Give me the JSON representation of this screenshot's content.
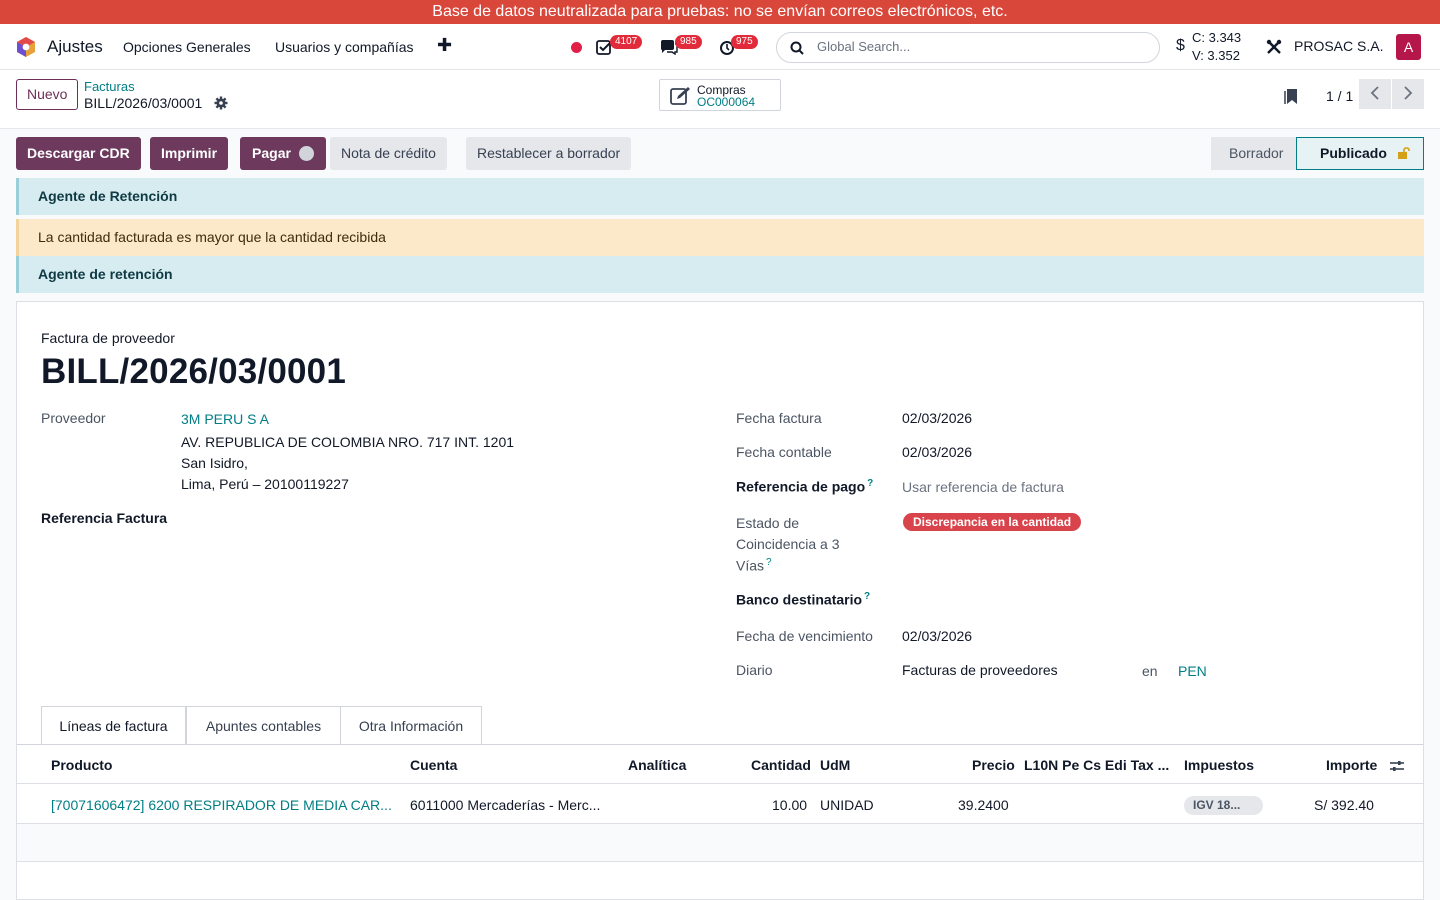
{
  "banner": {
    "text": "Base de datos neutralizada para pruebas: no se envían correos electrónicos, etc."
  },
  "navbar": {
    "app_name": "Ajustes",
    "menu": [
      "Opciones Generales",
      "Usuarios y compañías"
    ],
    "plus": "✚",
    "badges": {
      "activities": "4107",
      "messages": "985",
      "timer": "975"
    },
    "search_placeholder": "Global Search...",
    "rate_symbol": "$",
    "rate_buy": "C: 3.343",
    "rate_sell": "V: 3.352",
    "company": "PROSAC S.A.",
    "avatar_letter": "A"
  },
  "control": {
    "new_button": "Nuevo",
    "breadcrumb_parent": "Facturas",
    "breadcrumb_current": "BILL/2026/03/0001",
    "smart_button_label": "Compras",
    "smart_button_value": "OC000064",
    "pager": "1 / 1"
  },
  "actions": {
    "download_cdr": "Descargar CDR",
    "print": "Imprimir",
    "pay": "Pagar",
    "credit_note": "Nota de crédito",
    "reset_draft": "Restablecer a borrador"
  },
  "statusbar": {
    "draft": "Borrador",
    "posted": "Publicado"
  },
  "alerts": [
    {
      "type": "info",
      "text": "Agente de Retención"
    },
    {
      "type": "warning",
      "text": "La cantidad facturada es mayor que la cantidad recibida"
    },
    {
      "type": "info",
      "text": "Agente de retención"
    }
  ],
  "form": {
    "doc_type": "Factura de proveedor",
    "title": "BILL/2026/03/0001",
    "vendor_label": "Proveedor",
    "vendor_name": "3M PERU S A",
    "vendor_address": [
      "AV. REPUBLICA DE COLOMBIA NRO. 717 INT. 1201",
      "San Isidro,",
      "Lima, Perú – 20100119227"
    ],
    "ref_label": "Referencia Factura",
    "invoice_date_label": "Fecha factura",
    "invoice_date": "02/03/2026",
    "accounting_date_label": "Fecha contable",
    "accounting_date": "02/03/2026",
    "payment_ref_label": "Referencia de pago",
    "payment_ref_placeholder": "Usar referencia de factura",
    "three_way_label": [
      "Estado de",
      "Coincidencia a 3",
      "Vías"
    ],
    "three_way_value": "Discrepancia en la cantidad",
    "bank_label": "Banco destinatario",
    "due_date_label": "Fecha de vencimiento",
    "due_date": "02/03/2026",
    "journal_label": "Diario",
    "journal": "Facturas de proveedores",
    "currency_in": "en",
    "currency": "PEN",
    "help_mark": "?"
  },
  "tabs": [
    "Líneas de factura",
    "Apuntes contables",
    "Otra Información"
  ],
  "lines": {
    "headers": [
      "Producto",
      "Cuenta",
      "Analítica",
      "Cantidad",
      "UdM",
      "Precio",
      "L10N Pe Cs Edi Tax ...",
      "Impuestos",
      "Importe"
    ],
    "rows": [
      {
        "product": "[70071606472] 6200 RESPIRADOR DE MEDIA CAR...",
        "account": "6011000 Mercaderías - Merc...",
        "analytic": "",
        "quantity": "10.00",
        "uom": "UNIDAD",
        "price": "39.2400",
        "l10n": "",
        "taxes": "IGV 18...",
        "amount": "S/ 392.40"
      }
    ]
  }
}
